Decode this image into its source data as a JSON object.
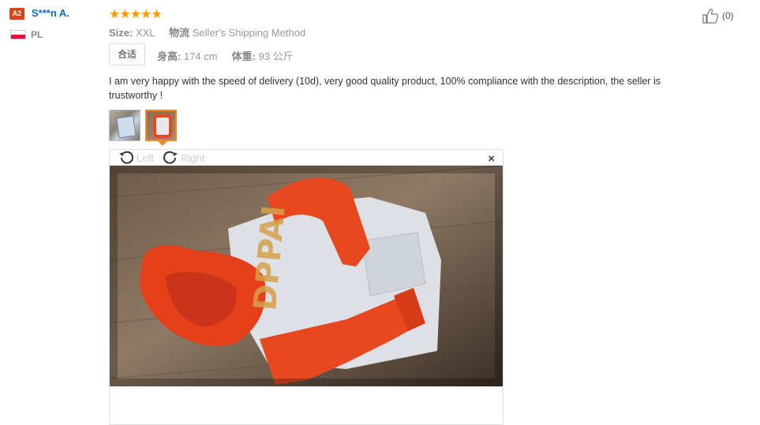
{
  "reviewer": {
    "level_badge": "A2",
    "name": "S***n A.",
    "country_code": "PL"
  },
  "rating": {
    "stars_display": "★★★★★",
    "value": 5,
    "max": 5,
    "color": "#ff9900"
  },
  "helpful": {
    "count_label": "(0)",
    "icon": "thumbs-up-icon"
  },
  "meta": {
    "size_label": "Size:",
    "size_value": "XXL",
    "shipping_label": "物流",
    "shipping_value": "Seller's Shipping Method"
  },
  "fit": {
    "label": "合适"
  },
  "body": {
    "height_label": "身高:",
    "height_value": "174 cm",
    "weight_label": "体重:",
    "weight_value": "93 公斤"
  },
  "review_text": "I am very happy with the speed of delivery (10d), very good quality product, 100% compliance with the description, the seller is trustworthy !",
  "viewer": {
    "rotate_left_label": "Left",
    "rotate_right_label": "Right",
    "close_label": "×",
    "photo_print_text": "DPPAI"
  },
  "colors": {
    "username": "#0a6ec4",
    "badge": "#d9451b",
    "thumb_selected": "#f08a24"
  }
}
